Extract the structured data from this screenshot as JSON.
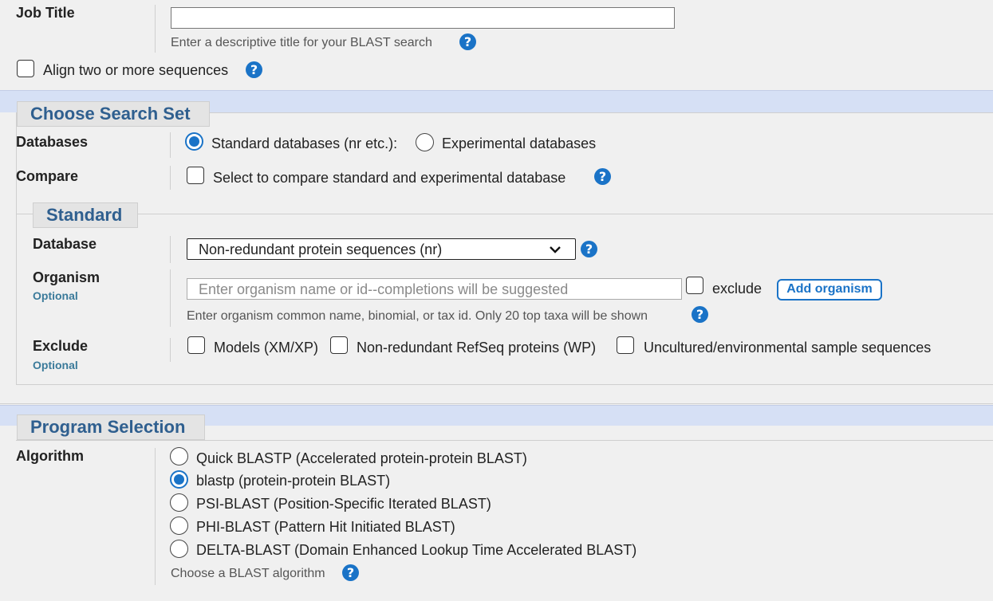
{
  "job_title": {
    "label": "Job Title",
    "value": "",
    "hint": "Enter a descriptive title for your BLAST search"
  },
  "align_two": {
    "label": "Align two or more sequences",
    "checked": false
  },
  "search_set": {
    "legend": "Choose Search Set",
    "databases_label": "Databases",
    "standard_option": "Standard databases (nr etc.):",
    "experimental_option": "Experimental databases",
    "compare_label": "Compare",
    "compare_option": "Select to compare standard and experimental database"
  },
  "standard": {
    "legend": "Standard",
    "database_label": "Database",
    "database_value": "Non-redundant protein sequences (nr)",
    "organism_label": "Organism",
    "optional_label": "Optional",
    "organism_placeholder": "Enter organism name or id--completions will be suggested",
    "exclude_checkbox_label": "exclude",
    "add_organism_button": "Add organism",
    "organism_hint": "Enter organism common name, binomial, or tax id. Only 20 top taxa will be shown",
    "exclude_label": "Exclude",
    "exclude_optional": "Optional",
    "exclude_options": [
      "Models (XM/XP)",
      "Non-redundant RefSeq proteins (WP)",
      "Uncultured/environmental sample sequences"
    ]
  },
  "program": {
    "legend": "Program Selection",
    "algorithm_label": "Algorithm",
    "options": [
      {
        "label": "Quick BLASTP (Accelerated protein-protein BLAST)",
        "selected": false
      },
      {
        "label": "blastp (protein-protein BLAST)",
        "selected": true
      },
      {
        "label": "PSI-BLAST (Position-Specific Iterated BLAST)",
        "selected": false
      },
      {
        "label": "PHI-BLAST (Pattern Hit Initiated BLAST)",
        "selected": false
      },
      {
        "label": "DELTA-BLAST (Domain Enhanced Lookup Time Accelerated BLAST)",
        "selected": false
      }
    ],
    "hint": "Choose a BLAST algorithm"
  },
  "icons": {
    "help": "help-question-icon",
    "dropdown": "chevron-down-icon"
  },
  "colors": {
    "accent": "#1a73c7",
    "band": "#d6e0f5",
    "legend_text": "#2f5f8f"
  }
}
